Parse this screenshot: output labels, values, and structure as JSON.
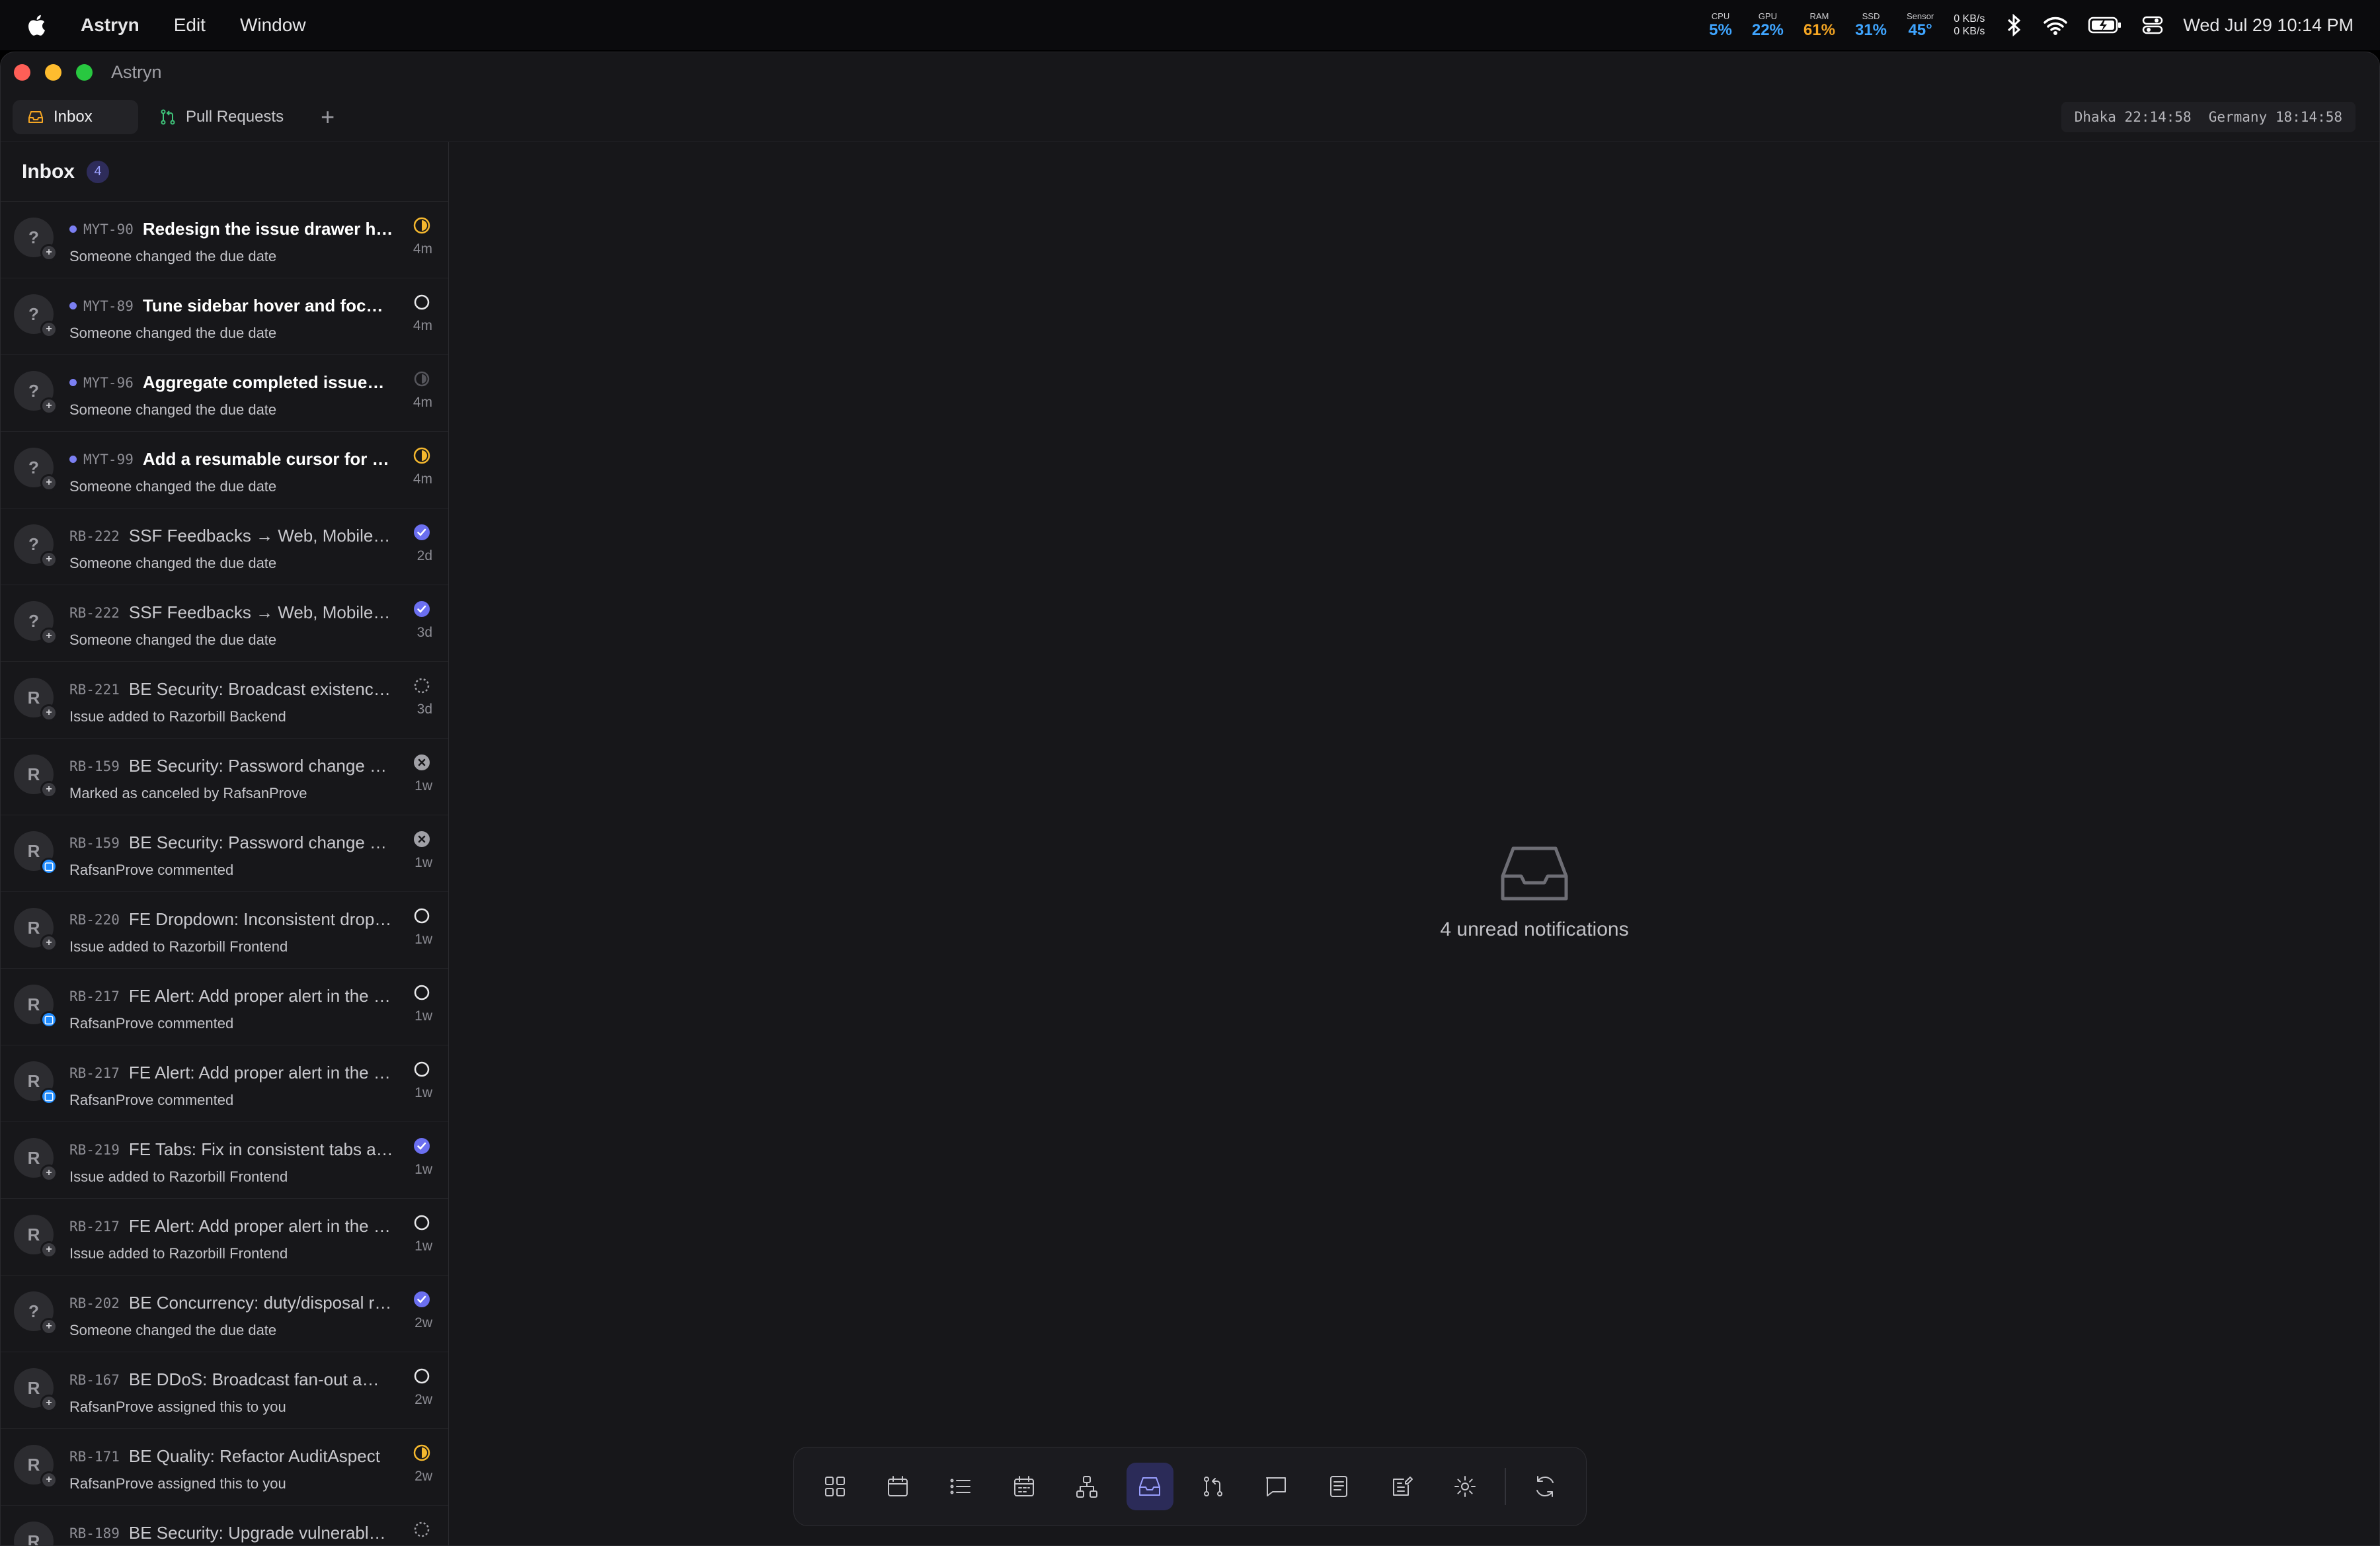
{
  "menubar": {
    "app": "Astryn",
    "menus": [
      "Edit",
      "Window"
    ],
    "stats": [
      {
        "label": "CPU",
        "value": "5%",
        "tone": "normal"
      },
      {
        "label": "GPU",
        "value": "22%",
        "tone": "normal"
      },
      {
        "label": "RAM",
        "value": "61%",
        "tone": "warn"
      },
      {
        "label": "SSD",
        "value": "31%",
        "tone": "normal"
      },
      {
        "label": "Sensor",
        "value": "45°",
        "tone": "normal"
      }
    ],
    "net_up": "0 KB/s",
    "net_down": "0 KB/s",
    "datetime": "Wed Jul 29  10:14 PM"
  },
  "window": {
    "title": "Astryn"
  },
  "tabs": [
    {
      "label": "Inbox",
      "icon": "inbox-icon",
      "active": true
    },
    {
      "label": "Pull Requests",
      "icon": "git-pull-request-icon",
      "active": false
    }
  ],
  "clocks": {
    "dhaka": "Dhaka 22:14:58",
    "germany": "Germany 18:14:58"
  },
  "sidebar": {
    "title": "Inbox",
    "unread_count": "4",
    "items": [
      {
        "key": "MYT-90",
        "title": "Redesign the issue drawer header",
        "subtitle": "Someone changed the due date",
        "age": "4m",
        "status": "in-progress",
        "unread": true,
        "avatar": "?",
        "sub": "plus"
      },
      {
        "key": "MYT-89",
        "title": "Tune sidebar hover and focus states",
        "subtitle": "Someone changed the due date",
        "age": "4m",
        "status": "todo",
        "unread": true,
        "avatar": "?",
        "sub": "plus"
      },
      {
        "key": "MYT-96",
        "title": "Aggregate completed issues by cycle",
        "subtitle": "Someone changed the due date",
        "age": "4m",
        "status": "paused",
        "unread": true,
        "avatar": "?",
        "sub": "plus"
      },
      {
        "key": "MYT-99",
        "title": "Add a resumable cursor for inbox sync",
        "subtitle": "Someone changed the due date",
        "age": "4m",
        "status": "in-progress",
        "unread": true,
        "avatar": "?",
        "sub": "plus"
      },
      {
        "key": "RB-222",
        "title": "SSF Feedbacks → Web, Mobile & Admin",
        "subtitle": "Someone changed the due date",
        "age": "2d",
        "status": "done",
        "unread": false,
        "avatar": "?",
        "sub": "plus"
      },
      {
        "key": "RB-222",
        "title": "SSF Feedbacks → Web, Mobile & Admin",
        "subtitle": "Someone changed the due date",
        "age": "3d",
        "status": "done",
        "unread": false,
        "avatar": "?",
        "sub": "plus"
      },
      {
        "key": "RB-221",
        "title": "BE Security: Broadcast existence leak",
        "subtitle": "Issue added to Razorbill Backend",
        "age": "3d",
        "status": "backlog",
        "unread": false,
        "avatar": "R",
        "sub": "plus"
      },
      {
        "key": "RB-159",
        "title": "BE Security: Password change does not revoke sessions",
        "subtitle": "Marked as canceled by RafsanProve",
        "age": "1w",
        "status": "canceled",
        "unread": false,
        "avatar": "R",
        "sub": "plus"
      },
      {
        "key": "RB-159",
        "title": "BE Security: Password change does not revoke sessions",
        "subtitle": "RafsanProve commented",
        "age": "1w",
        "status": "canceled",
        "unread": false,
        "avatar": "R",
        "sub": "comment"
      },
      {
        "key": "RB-220",
        "title": "FE Dropdown: Inconsistent dropdown styles",
        "subtitle": "Issue added to Razorbill Frontend",
        "age": "1w",
        "status": "todo",
        "unread": false,
        "avatar": "R",
        "sub": "plus"
      },
      {
        "key": "RB-217",
        "title": "FE Alert: Add proper alert in the app",
        "subtitle": "RafsanProve commented",
        "age": "1w",
        "status": "todo",
        "unread": false,
        "avatar": "R",
        "sub": "comment"
      },
      {
        "key": "RB-217",
        "title": "FE Alert: Add proper alert in the app",
        "subtitle": "RafsanProve commented",
        "age": "1w",
        "status": "todo",
        "unread": false,
        "avatar": "R",
        "sub": "comment"
      },
      {
        "key": "RB-219",
        "title": "FE Tabs: Fix in consistent tabs across pages",
        "subtitle": "Issue added to Razorbill Frontend",
        "age": "1w",
        "status": "done",
        "unread": false,
        "avatar": "R",
        "sub": "plus"
      },
      {
        "key": "RB-217",
        "title": "FE Alert: Add proper alert in the app",
        "subtitle": "Issue added to Razorbill Frontend",
        "age": "1w",
        "status": "todo",
        "unread": false,
        "avatar": "R",
        "sub": "plus"
      },
      {
        "key": "RB-202",
        "title": "BE Concurrency: duty/disposal race",
        "subtitle": "Someone changed the due date",
        "age": "2w",
        "status": "done",
        "unread": false,
        "avatar": "?",
        "sub": "plus"
      },
      {
        "key": "RB-167",
        "title": "BE DDoS: Broadcast fan-out amplification",
        "subtitle": "RafsanProve assigned this to you",
        "age": "2w",
        "status": "todo",
        "unread": false,
        "avatar": "R",
        "sub": "plus"
      },
      {
        "key": "RB-171",
        "title": "BE Quality: Refactor AuditAspect",
        "subtitle": "RafsanProve assigned this to you",
        "age": "2w",
        "status": "in-progress",
        "unread": false,
        "avatar": "R",
        "sub": "plus"
      },
      {
        "key": "RB-189",
        "title": "BE Security: Upgrade vulnerable dependencies",
        "subtitle": "",
        "age": "",
        "status": "backlog",
        "unread": false,
        "avatar": "R",
        "sub": "plus"
      }
    ]
  },
  "main": {
    "empty_message": "4 unread notifications"
  },
  "dock": {
    "items": [
      "grid-icon",
      "calendar-icon",
      "list-icon",
      "calendar-days-icon",
      "hierarchy-icon",
      "inbox-icon",
      "git-pull-request-icon",
      "chat-icon",
      "document-icon",
      "edit-note-icon",
      "settings-icon"
    ],
    "active": "inbox-icon",
    "trailing": "refresh-icon"
  },
  "colors": {
    "accent": "#7b7ff2",
    "in_progress": "#f5b82e",
    "done": "#6b6ff0"
  }
}
